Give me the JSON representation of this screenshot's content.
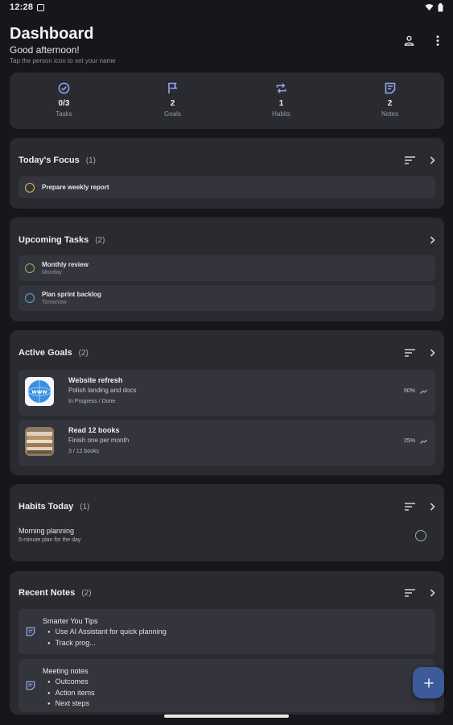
{
  "status_bar": {
    "time": "12:28"
  },
  "header": {
    "title": "Dashboard",
    "greeting": "Good afternoon!",
    "hint": "Tap the person icon to set your name"
  },
  "stats": [
    {
      "icon": "check-circle-icon",
      "value": "0/3",
      "label": "Tasks"
    },
    {
      "icon": "flag-icon",
      "value": "2",
      "label": "Goals"
    },
    {
      "icon": "repeat-icon",
      "value": "1",
      "label": "Habits"
    },
    {
      "icon": "note-icon",
      "value": "2",
      "label": "Notes"
    }
  ],
  "focus": {
    "title": "Today's Focus",
    "count": "(1)",
    "items": [
      {
        "title": "Prepare weekly report",
        "color": "#e4c04a"
      }
    ]
  },
  "upcoming": {
    "title": "Upcoming Tasks",
    "count": "(2)",
    "items": [
      {
        "title": "Monthly review",
        "due": "Monday",
        "color": "#7fc06a"
      },
      {
        "title": "Plan sprint backlog",
        "due": "Tomorrow",
        "color": "#5aa8e0"
      }
    ]
  },
  "goals": {
    "title": "Active Goals",
    "count": "(2)",
    "items": [
      {
        "title": "Website refresh",
        "desc": "Polish landing and docs",
        "progress_text": "In Progress / Done",
        "percent": "50%",
        "thumb": "www-globe"
      },
      {
        "title": "Read 12 books",
        "desc": "Finish one per month",
        "progress_text": "3 / 12 books",
        "percent": "25%",
        "thumb": "books-photo"
      }
    ]
  },
  "habits": {
    "title": "Habits Today",
    "count": "(1)",
    "items": [
      {
        "title": "Morning planning",
        "desc": "5-minute plan for the day"
      }
    ]
  },
  "notes": {
    "title": "Recent Notes",
    "count": "(2)",
    "items": [
      {
        "title": "Smarter You Tips",
        "bullets": [
          "Use AI Assistant for quick planning",
          "Track prog..."
        ]
      },
      {
        "title": "Meeting notes",
        "bullets": [
          "Outcomes",
          "Action items",
          "Next steps"
        ]
      }
    ]
  },
  "colors": {
    "background": "#16171b",
    "card": "#2a2b31",
    "row": "#34353c",
    "accent": "#8fa8e8",
    "fab": "#3d5a9a"
  }
}
